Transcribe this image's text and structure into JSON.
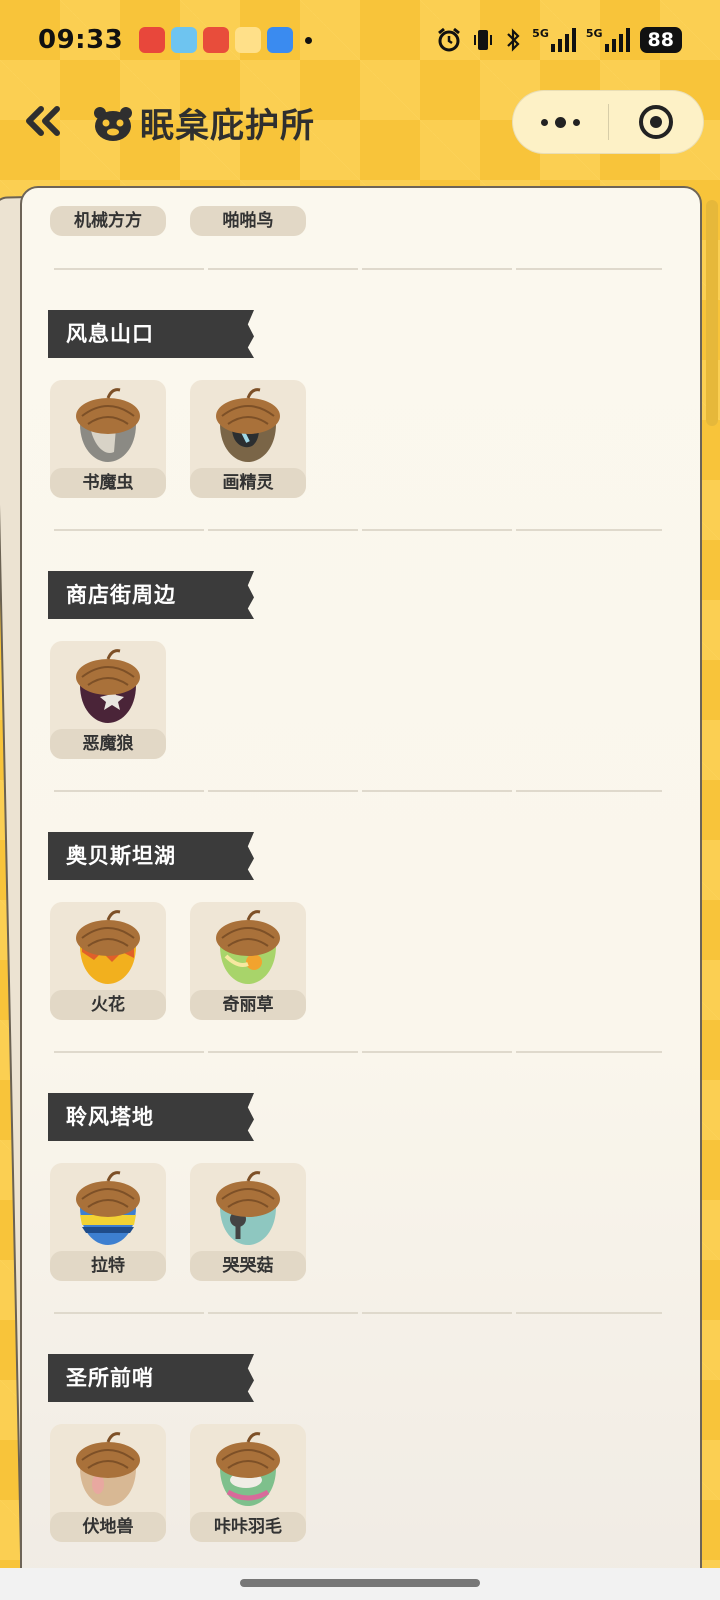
{
  "status_bar": {
    "time": "09:33",
    "network_1": "5G",
    "network_2": "5G",
    "battery": "88"
  },
  "header": {
    "title": "眠枲庇护所",
    "icons": {
      "back": "double-chevron-left-icon",
      "logo": "pet-face-icon",
      "more": "more-dots-icon",
      "close": "target-close-icon"
    }
  },
  "top_partial": {
    "items": [
      "机械方方",
      "啪啪鸟"
    ]
  },
  "sections": [
    {
      "title": "风息山口",
      "items": [
        {
          "name": "书魔虫",
          "icon": "acorn-bookworm-icon"
        },
        {
          "name": "画精灵",
          "icon": "acorn-painter-icon"
        }
      ]
    },
    {
      "title": "商店街周边",
      "items": [
        {
          "name": "恶魔狼",
          "icon": "acorn-demon-wolf-icon"
        }
      ]
    },
    {
      "title": "奥贝斯坦湖",
      "items": [
        {
          "name": "火花",
          "icon": "acorn-spark-icon"
        },
        {
          "name": "奇丽草",
          "icon": "acorn-grass-icon"
        }
      ]
    },
    {
      "title": "聆风塔地",
      "items": [
        {
          "name": "拉特",
          "icon": "acorn-rat-icon"
        },
        {
          "name": "哭哭菇",
          "icon": "acorn-mushroom-icon"
        }
      ]
    },
    {
      "title": "圣所前哨",
      "items": [
        {
          "name": "伏地兽",
          "icon": "acorn-ground-beast-icon"
        },
        {
          "name": "咔咔羽毛",
          "icon": "acorn-feather-icon"
        }
      ]
    }
  ],
  "colors": {
    "background": "#f8c43a",
    "paper": "#faf6ec",
    "tag": "#3b3b3b",
    "card": "#efe6d6",
    "acorn_cap": "#a9713a"
  }
}
